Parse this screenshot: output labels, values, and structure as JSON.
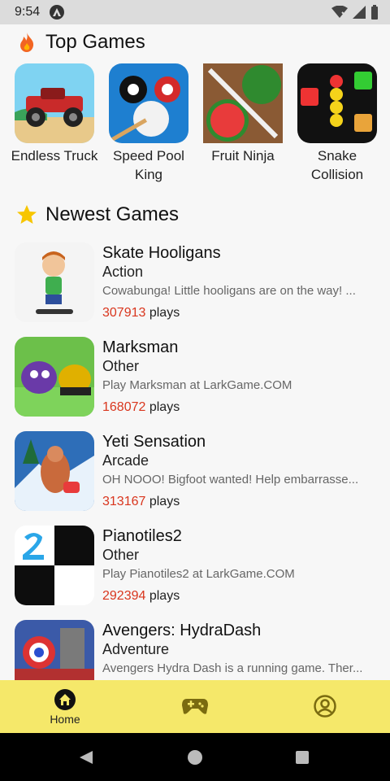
{
  "status_bar": {
    "time": "9:54",
    "notification_icon": "app-notification-icon"
  },
  "top_games": {
    "title": "Top Games",
    "icon": "fire-icon",
    "items": [
      {
        "name": "Endless Truck"
      },
      {
        "name": "Speed Pool King"
      },
      {
        "name": "Fruit Ninja"
      },
      {
        "name": "Snake Collision"
      }
    ]
  },
  "newest_games": {
    "title": "Newest Games",
    "icon": "star-icon",
    "items": [
      {
        "title": "Skate Hooligans",
        "category": "Action",
        "description": "Cowabunga! Little hooligans are on the way! ...",
        "plays_count": "307913",
        "plays_label": "plays"
      },
      {
        "title": "Marksman",
        "category": "Other",
        "description": "Play Marksman at LarkGame.COM",
        "plays_count": "168072",
        "plays_label": "plays"
      },
      {
        "title": "Yeti Sensation",
        "category": "Arcade",
        "description": "OH NOOO! Bigfoot wanted! Help embarrasse...",
        "plays_count": "313167",
        "plays_label": "plays"
      },
      {
        "title": "Pianotiles2",
        "category": "Other",
        "description": "Play Pianotiles2 at LarkGame.COM",
        "plays_count": "292394",
        "plays_label": "plays"
      },
      {
        "title": "Avengers: HydraDash",
        "category": "Adventure",
        "description": "Avengers Hydra Dash is a running game. Ther...",
        "plays_count": "",
        "plays_label": ""
      }
    ]
  },
  "bottom_nav": {
    "items": [
      {
        "label": "Home",
        "icon": "home-icon",
        "active": true
      },
      {
        "label": "",
        "icon": "gamepad-icon"
      },
      {
        "label": "",
        "icon": "profile-icon"
      }
    ]
  },
  "colors": {
    "nav_bg": "#f5e86a",
    "play_count": "#d9361e",
    "accent": "#f7c600"
  }
}
